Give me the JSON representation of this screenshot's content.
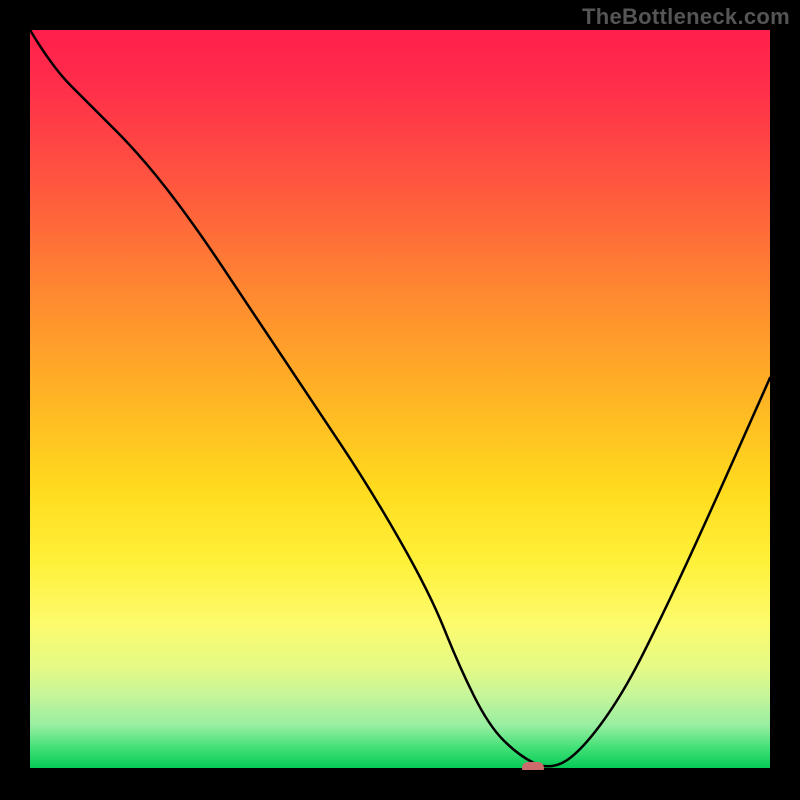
{
  "watermark": "TheBottleneck.com",
  "chart_data": {
    "type": "line",
    "title": "",
    "xlabel": "",
    "ylabel": "",
    "xlim": [
      0,
      100
    ],
    "ylim": [
      0,
      100
    ],
    "grid": false,
    "series": [
      {
        "name": "bottleneck-curve",
        "x": [
          0,
          3,
          8,
          15,
          22,
          30,
          38,
          46,
          54,
          58,
          62,
          66,
          70,
          74,
          80,
          86,
          92,
          100
        ],
        "values": [
          100,
          95,
          90,
          83,
          74,
          62,
          50,
          38,
          24,
          14,
          6,
          2,
          0,
          2,
          10,
          22,
          35,
          53
        ]
      }
    ],
    "annotations": [
      {
        "name": "optimal-marker",
        "x": 68,
        "y": 0
      }
    ],
    "gradient_stops_pct": {
      "red": 0,
      "yellow": 62,
      "green": 100
    }
  }
}
